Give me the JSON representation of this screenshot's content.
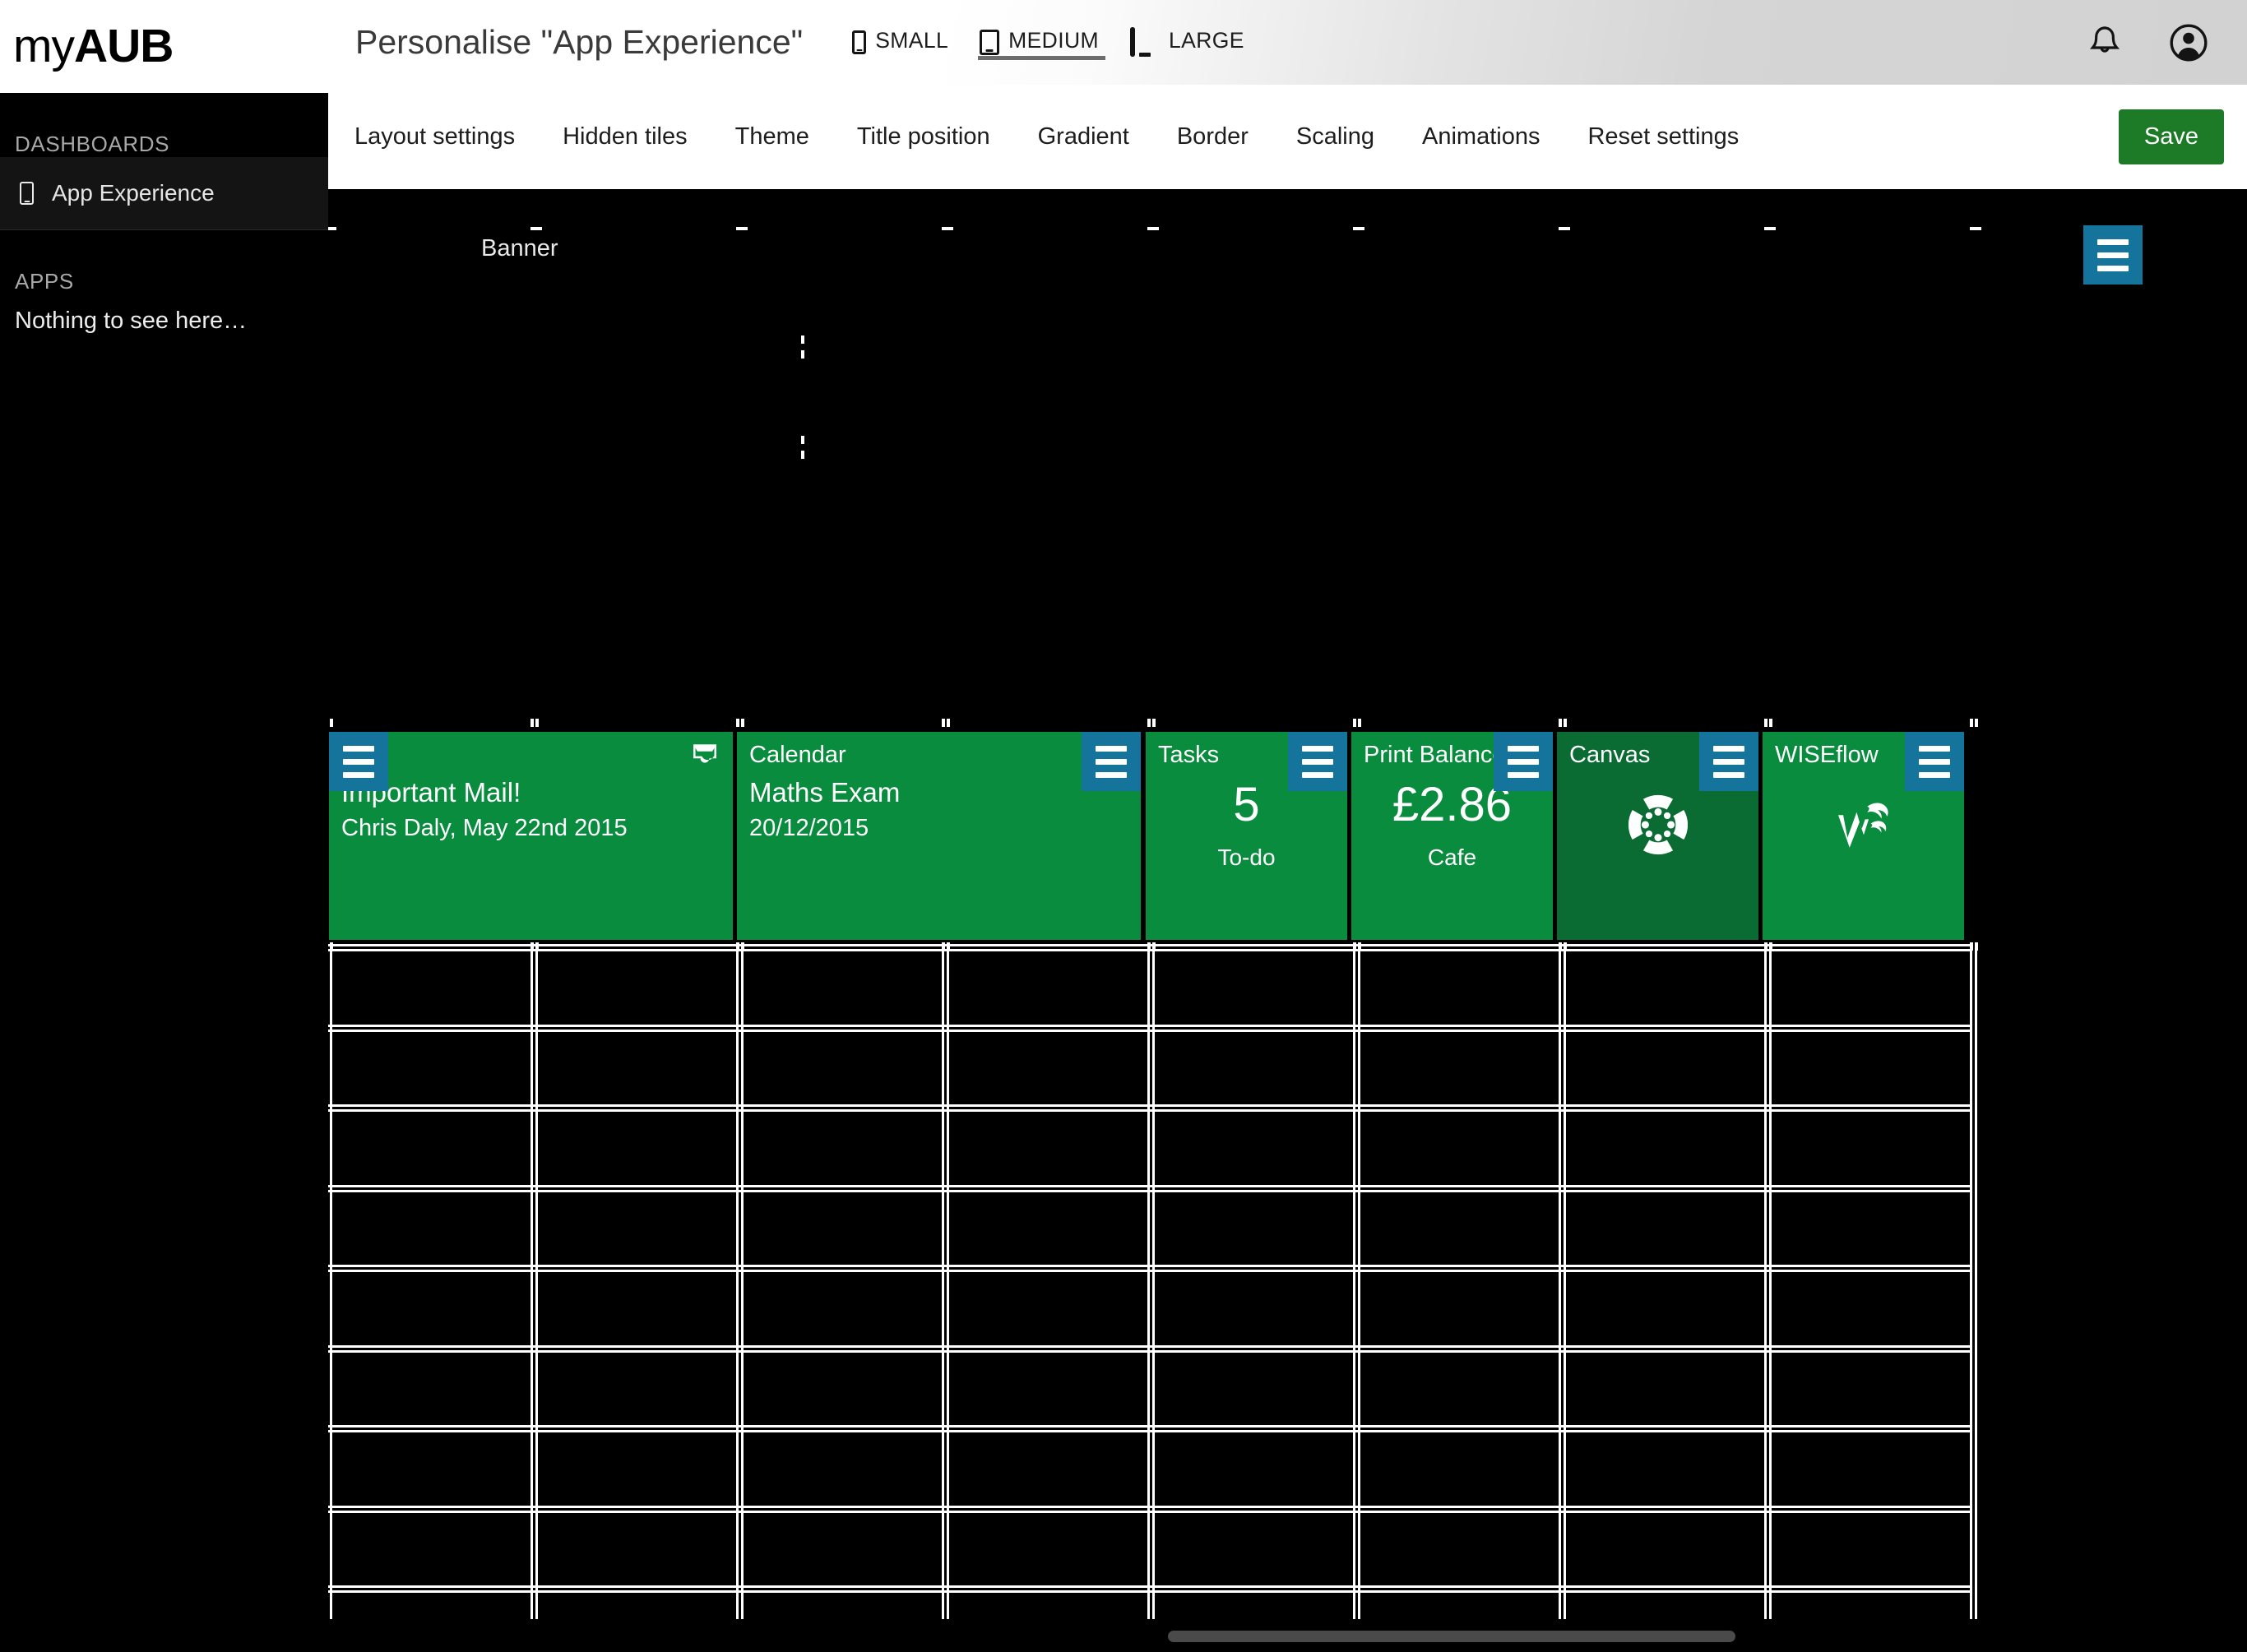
{
  "brand": {
    "logo_light": "my",
    "logo_bold": "AUB"
  },
  "sidebar": {
    "dashboards_heading": "DASHBOARDS",
    "dashboard_items": [
      {
        "label": "App Experience",
        "icon": "phone-icon"
      }
    ],
    "apps_heading": "APPS",
    "apps_empty_text": "Nothing to see here…"
  },
  "header": {
    "title": "Personalise \"App Experience\"",
    "size_options": [
      {
        "label": "SMALL",
        "icon": "phone-icon",
        "selected": false
      },
      {
        "label": "MEDIUM",
        "icon": "tablet-icon",
        "selected": true
      },
      {
        "label": "LARGE",
        "icon": "monitor-icon",
        "selected": false
      }
    ],
    "icons": [
      "notification-bell-icon",
      "user-account-icon"
    ]
  },
  "nav": {
    "items": [
      "Layout settings",
      "Hidden tiles",
      "Theme",
      "Title position",
      "Gradient",
      "Border",
      "Scaling",
      "Animations",
      "Reset settings"
    ],
    "save_label": "Save"
  },
  "canvas": {
    "banner_label": "Banner",
    "banner_menu_icon": "hamburger-menu-icon",
    "tiles": [
      {
        "name": "mail",
        "title": "Important Mail!",
        "subtitle": "Chris Daly, May 22nd 2015",
        "corner_icon": "inbox-icon",
        "menu_icon": "hamburger-menu-icon",
        "menu_side": "left"
      },
      {
        "name": "calendar",
        "title": "Calendar",
        "line1": "Maths Exam",
        "line2": "20/12/2015",
        "menu_icon": "hamburger-menu-icon",
        "menu_side": "right"
      },
      {
        "name": "tasks",
        "title": "Tasks",
        "value": "5",
        "caption": "To-do",
        "menu_icon": "hamburger-menu-icon",
        "menu_side": "right"
      },
      {
        "name": "print-balance",
        "title": "Print Balance",
        "value": "£2.86",
        "caption": "Cafe",
        "menu_icon": "hamburger-menu-icon",
        "menu_side": "right"
      },
      {
        "name": "canvas",
        "title": "Canvas",
        "logo": "canvas-logo-icon",
        "menu_icon": "hamburger-menu-icon",
        "menu_side": "right"
      },
      {
        "name": "wiseflow",
        "title": "WISEflow",
        "logo": "wiseflow-logo-icon",
        "menu_icon": "hamburger-menu-icon",
        "menu_side": "right"
      }
    ]
  },
  "colors": {
    "tile_green": "#0a8c3f",
    "tile_green_dark": "#0a6b33",
    "menu_blue": "#15749b",
    "save_green": "#1d7a27",
    "canvas_background": "#000000",
    "grid_line": "#ffffff"
  }
}
